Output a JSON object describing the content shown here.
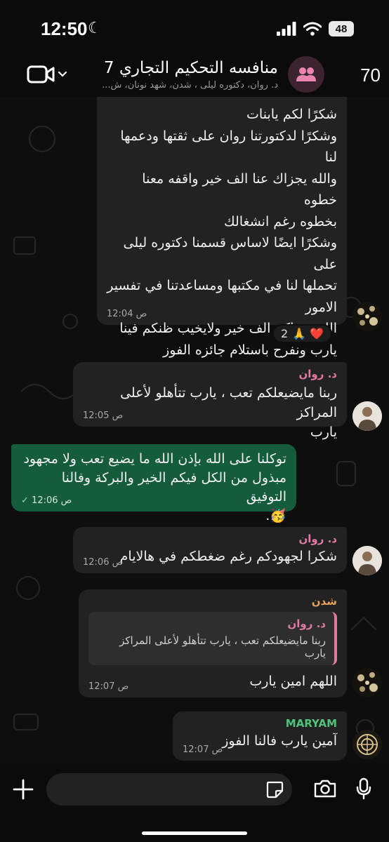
{
  "status": {
    "time": "12:50",
    "battery": "48"
  },
  "header": {
    "back_count": "70",
    "title": "منافسه التحكيم التجاري 7",
    "subtitle": "د. روان، دكتوره ليلى ، شدن، شهد نونان، ش..."
  },
  "messages": [
    {
      "id": "m1",
      "text": "شكرًا لكم يابنات\nوشكرًا لدكتورتنا روان على ثقتها ودعمها لنا\nوالله يجزاك عنا الف خير واقفه معنا خطوه\nبخطوه رغم انشغالك\nوشكرًا ايضًا لاساس قسمنا دكتوره ليلى على\nتحملها لنا في مكتبها ومساعدتنا في تفسير\nالامور\nالله يجزاكم الف خير ولايخيب ظنكم فينا\nيارب ونفرح باستلام جائزه الفوز\nالله يوفقنا في اختباراتنا ونجيب درجات\nترضينا 🤍🤍",
      "time": "12:04 ص",
      "reactions": {
        "emojis": "🙏 ❤️",
        "count": "2"
      }
    },
    {
      "id": "m2",
      "sender": "د. روان",
      "text": "ربنا مايضيعلكم تعب ، يارب تتأهلو لأعلى المراكز\nيارب",
      "time": "12:05 ص"
    },
    {
      "id": "m3",
      "text": "توكلنا على الله بإذن الله ما يضيع تعب ولا مجهود\nمبذول من الكل فيكم الخير والبركة وفالنا التوفيق\n🥳.",
      "time": "12:06 ص"
    },
    {
      "id": "m4",
      "sender": "د. روان",
      "text": "شكرا لجهودكم رغم ضغطكم في هالايام",
      "time": "12:06 ص"
    },
    {
      "id": "m5",
      "sender": "شدن",
      "quote": {
        "sender": "د. روان",
        "text": "ربنا مايضيعلكم تعب ، يارب تتأهلو لأعلى المراكز يارب"
      },
      "text": "اللهم امين يارب",
      "time": "12:07 ص"
    },
    {
      "id": "m6",
      "sender": "MARYAM",
      "text": "آمين يارب فالنا الفوز",
      "time": "12:07 ص"
    }
  ],
  "colors": {
    "incoming_bubble": "#222222",
    "outgoing_bubble": "#155c3d",
    "sender_rawan": "#e07aa3",
    "sender_shadan": "#e8a25c",
    "sender_maryam": "#4fc37c",
    "read_check": "#8fd8b0"
  },
  "icons": [
    "video-camera-icon",
    "chevron-down-icon",
    "group-icon",
    "plus-icon",
    "sticker-icon",
    "camera-icon",
    "microphone-icon",
    "signal-icon",
    "wifi-icon",
    "moon-icon"
  ]
}
